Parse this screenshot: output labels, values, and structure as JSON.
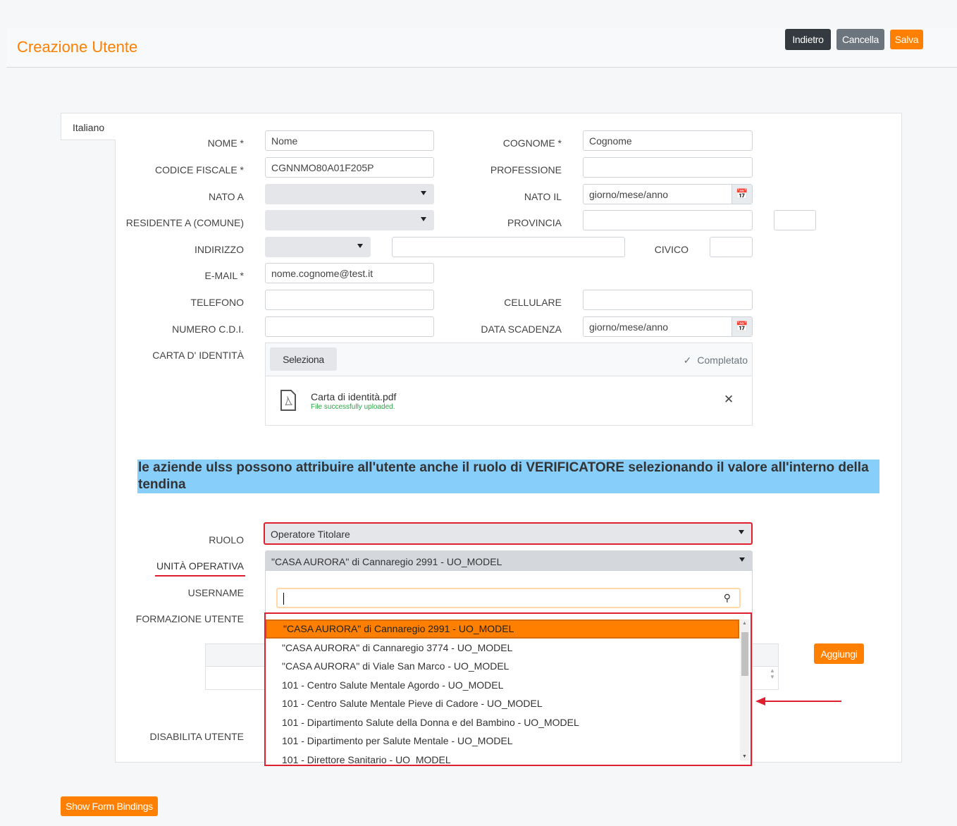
{
  "header": {
    "title": "Creazione Utente",
    "buttons": {
      "back": "Indietro",
      "cancel": "Cancella",
      "save": "Salva"
    }
  },
  "tab": "Italiano",
  "form": {
    "nome": {
      "label": "NOME *",
      "value": "Nome"
    },
    "cognome": {
      "label": "COGNOME *",
      "value": "Cognome"
    },
    "codice_fiscale": {
      "label": "CODICE FISCALE *",
      "value": "CGNNMO80A01F205P"
    },
    "professione": {
      "label": "PROFESSIONE",
      "value": ""
    },
    "nato_a": {
      "label": "NATO A",
      "value": ""
    },
    "nato_il": {
      "label": "NATO IL",
      "value": "giorno/mese/anno"
    },
    "residente": {
      "label": "RESIDENTE A (COMUNE)",
      "value": ""
    },
    "provincia": {
      "label": "PROVINCIA",
      "value": ""
    },
    "indirizzo": {
      "label": "INDIRIZZO",
      "value": ""
    },
    "civico": {
      "label": "CIVICO",
      "value": ""
    },
    "email": {
      "label": "E-MAIL *",
      "value": "nome.cognome@test.it"
    },
    "telefono": {
      "label": "TELEFONO",
      "value": ""
    },
    "cellulare": {
      "label": "CELLULARE",
      "value": ""
    },
    "numero_cdi": {
      "label": "NUMERO C.D.I.",
      "value": ""
    },
    "data_scadenza": {
      "label": "DATA SCADENZA",
      "value": "giorno/mese/anno"
    },
    "carta": {
      "label": "CARTA D' IDENTITÀ",
      "select": "Seleziona",
      "status": "Completato",
      "file_name": "Carta di identità.pdf",
      "file_status": "File successfully uploaded."
    }
  },
  "notice": "le aziende ulss possono attribuire all'utente anche il ruolo di VERIFICATORE selezionando il valore all'interno della tendina",
  "ruolo": {
    "label": "RUOLO",
    "value": "Operatore Titolare"
  },
  "unita": {
    "label": "UNITÀ OPERATIVA",
    "value": "\"CASA AURORA\" di Cannaregio 2991 - UO_MODEL",
    "search": "",
    "options": [
      "\"CASA AURORA\" di Cannaregio 2991 - UO_MODEL",
      "\"CASA AURORA\" di Cannaregio 3774 - UO_MODEL",
      "\"CASA AURORA\" di Viale San Marco - UO_MODEL",
      "101 - Centro Salute Mentale Agordo - UO_MODEL",
      "101 - Centro Salute Mentale Pieve di Cadore - UO_MODEL",
      "101 - Dipartimento Salute della Donna e del Bambino - UO_MODEL",
      "101 - Dipartimento per Salute Mentale - UO_MODEL",
      "101 - Direttore Sanitario - UO_MODEL"
    ]
  },
  "username_label": "USERNAME",
  "formazione_label": "FORMAZIONE UTENTE",
  "aggiungi": "Aggiungi",
  "disabilita_label": "DISABILITA UTENTE",
  "show_bindings": "Show Form Bindings",
  "colors": {
    "accent": "#ff7f00",
    "notice_bg": "#87cefa",
    "highlight_border": "#e02030"
  }
}
